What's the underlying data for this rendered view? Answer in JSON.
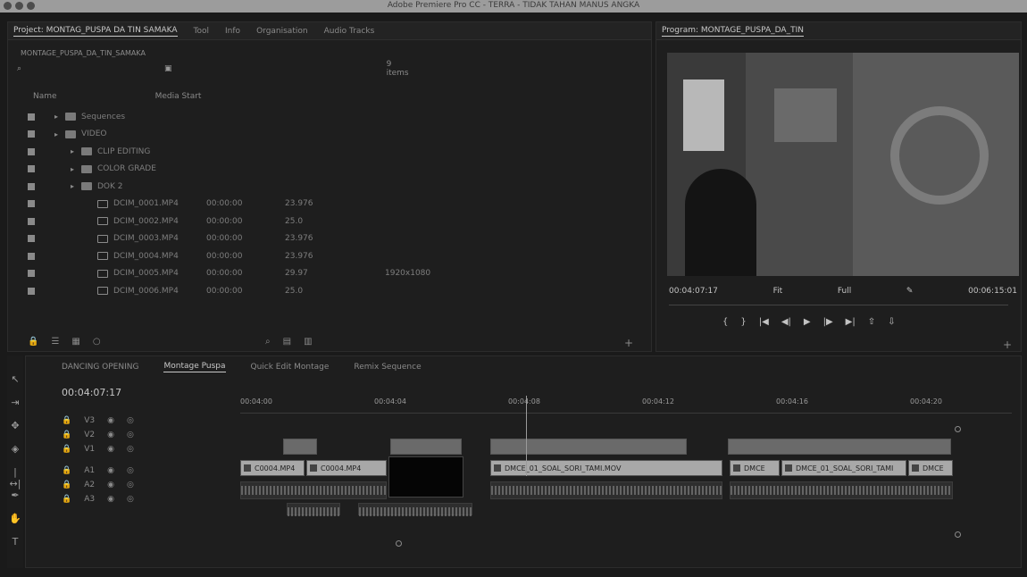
{
  "window": {
    "title": "Adobe Premiere Pro CC - TERRA - TIDAK TAHAN MANUS ANGKA"
  },
  "project": {
    "tabs": [
      "Project: MONTAG_PUSPA DA TIN SAMAKA",
      "Tool",
      "Info",
      "Organisation",
      "Audio Tracks"
    ],
    "active_tab": 0,
    "path": "MONTAGE_PUSPA_DA_TIN_SAMAKA",
    "items_count": "9 items",
    "col_name": "Name",
    "col_media": "Media Start",
    "rows": [
      {
        "name": "Sequences",
        "indent": 1,
        "type": "folder",
        "c2": "",
        "c3": "",
        "c4": ""
      },
      {
        "name": "VIDEO",
        "indent": 1,
        "type": "folder",
        "c2": "",
        "c3": "",
        "c4": ""
      },
      {
        "name": "CLIP EDITING",
        "indent": 2,
        "type": "folder",
        "c2": "",
        "c3": "",
        "c4": ""
      },
      {
        "name": "COLOR GRADE",
        "indent": 2,
        "type": "folder",
        "c2": "",
        "c3": "",
        "c4": ""
      },
      {
        "name": "DOK 2",
        "indent": 2,
        "type": "folder",
        "c2": "",
        "c3": "",
        "c4": ""
      },
      {
        "name": "DCIM_0001.MP4",
        "indent": 3,
        "type": "clip",
        "c2": "00:00:00",
        "c3": "23.976",
        "c4": ""
      },
      {
        "name": "DCIM_0002.MP4",
        "indent": 3,
        "type": "clip",
        "c2": "00:00:00",
        "c3": "25.0",
        "c4": ""
      },
      {
        "name": "DCIM_0003.MP4",
        "indent": 3,
        "type": "clip",
        "c2": "00:00:00",
        "c3": "23.976",
        "c4": ""
      },
      {
        "name": "DCIM_0004.MP4",
        "indent": 3,
        "type": "clip",
        "c2": "00:00:00",
        "c3": "23.976",
        "c4": ""
      },
      {
        "name": "DCIM_0005.MP4",
        "indent": 3,
        "type": "clip",
        "c2": "00:00:00",
        "c3": "29.97",
        "c4": "1920x1080"
      },
      {
        "name": "DCIM_0006.MP4",
        "indent": 3,
        "type": "clip",
        "c2": "00:00:00",
        "c3": "25.0",
        "c4": ""
      }
    ]
  },
  "program": {
    "tab": "Program: MONTAGE_PUSPA_DA_TIN",
    "timecode": "00:04:07:17",
    "fit": "Fit",
    "quality": "Full",
    "duration": "00:06:15:01"
  },
  "timeline": {
    "tabs": [
      "DANCING OPENING",
      "Montage Puspa",
      "Quick Edit Montage",
      "Remix Sequence"
    ],
    "active_tab": 1,
    "timecode": "00:04:07:17",
    "ruler": [
      "00:04:00",
      "00:04:04",
      "00:04:08",
      "00:04:12",
      "00:04:16",
      "00:04:20"
    ],
    "tracks": [
      "V3",
      "V2",
      "V1",
      "A1",
      "A2",
      "A3"
    ],
    "clips": {
      "c1": "C0004.MP4",
      "c2": "C0004.MP4",
      "c3": "DMCE_01_SOAL_SORI_TAMI.MOV",
      "c4": "DMCE",
      "c5": "DMCE_01_SOAL_SORI_TAMI",
      "c6": "DMCE"
    }
  }
}
